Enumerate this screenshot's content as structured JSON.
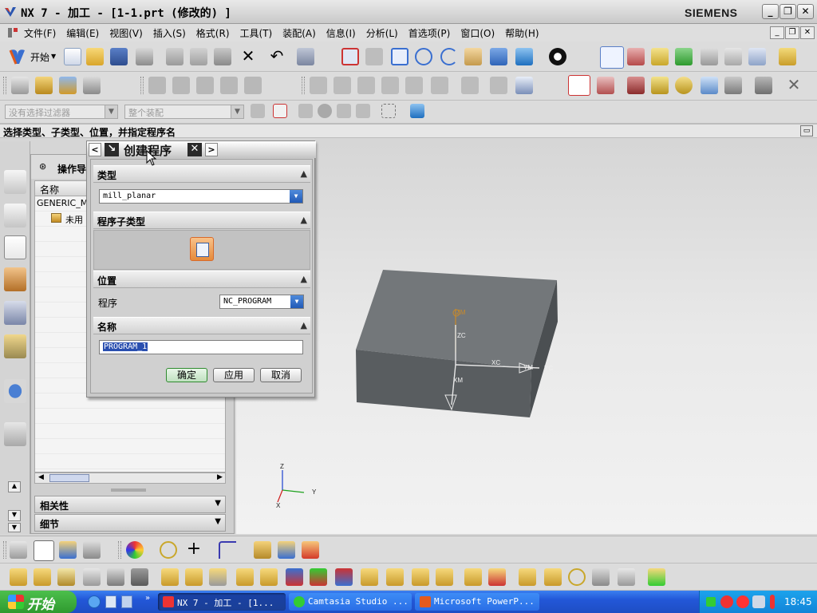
{
  "window": {
    "title": "NX 7 - 加工 - [1-1.prt (修改的) ]",
    "brand": "SIEMENS",
    "controls": {
      "minimize": "_",
      "maximize": "❐",
      "close": "✕"
    }
  },
  "menubar": {
    "items": [
      "文件(F)",
      "编辑(E)",
      "视图(V)",
      "插入(S)",
      "格式(R)",
      "工具(T)",
      "装配(A)",
      "信息(I)",
      "分析(L)",
      "首选项(P)",
      "窗口(O)",
      "帮助(H)"
    ]
  },
  "toolbar": {
    "start_label": "开始"
  },
  "filterbar": {
    "selection_filter": "没有选择过滤器",
    "scope": "整个装配"
  },
  "cue_line": "选择类型、子类型、位置，并指定程序名",
  "navigator": {
    "title": "操作导",
    "column": "名称",
    "rows": [
      "GENERIC_M",
      "未用"
    ],
    "sections": [
      "相关性",
      "细节"
    ]
  },
  "dialog": {
    "title": "创建程序",
    "sections": {
      "type": "类型",
      "subtype": "程序子类型",
      "location": "位置",
      "name": "名称"
    },
    "type_value": "mill_planar",
    "program_label": "程序",
    "program_value": "NC_PROGRAM",
    "name_value": "PROGRAM_1",
    "buttons": {
      "ok": "确定",
      "apply": "应用",
      "cancel": "取消"
    }
  },
  "viewport": {
    "labels": {
      "zm": "ZM",
      "zc": "ZC",
      "xc": "XC",
      "ym": "YM",
      "xm": "XM",
      "yc": "YC"
    },
    "triad": {
      "z": "Z",
      "y": "Y",
      "x": "X"
    }
  },
  "taskbar": {
    "start": "开始",
    "tasks": [
      "NX 7 - 加工 - [1...",
      "Camtasia Studio ...",
      "Microsoft PowerP..."
    ],
    "clock": "18:45"
  },
  "colors": {
    "accent": "#2357d8",
    "block": "#5f6366",
    "wcs": "#c98a2a"
  }
}
